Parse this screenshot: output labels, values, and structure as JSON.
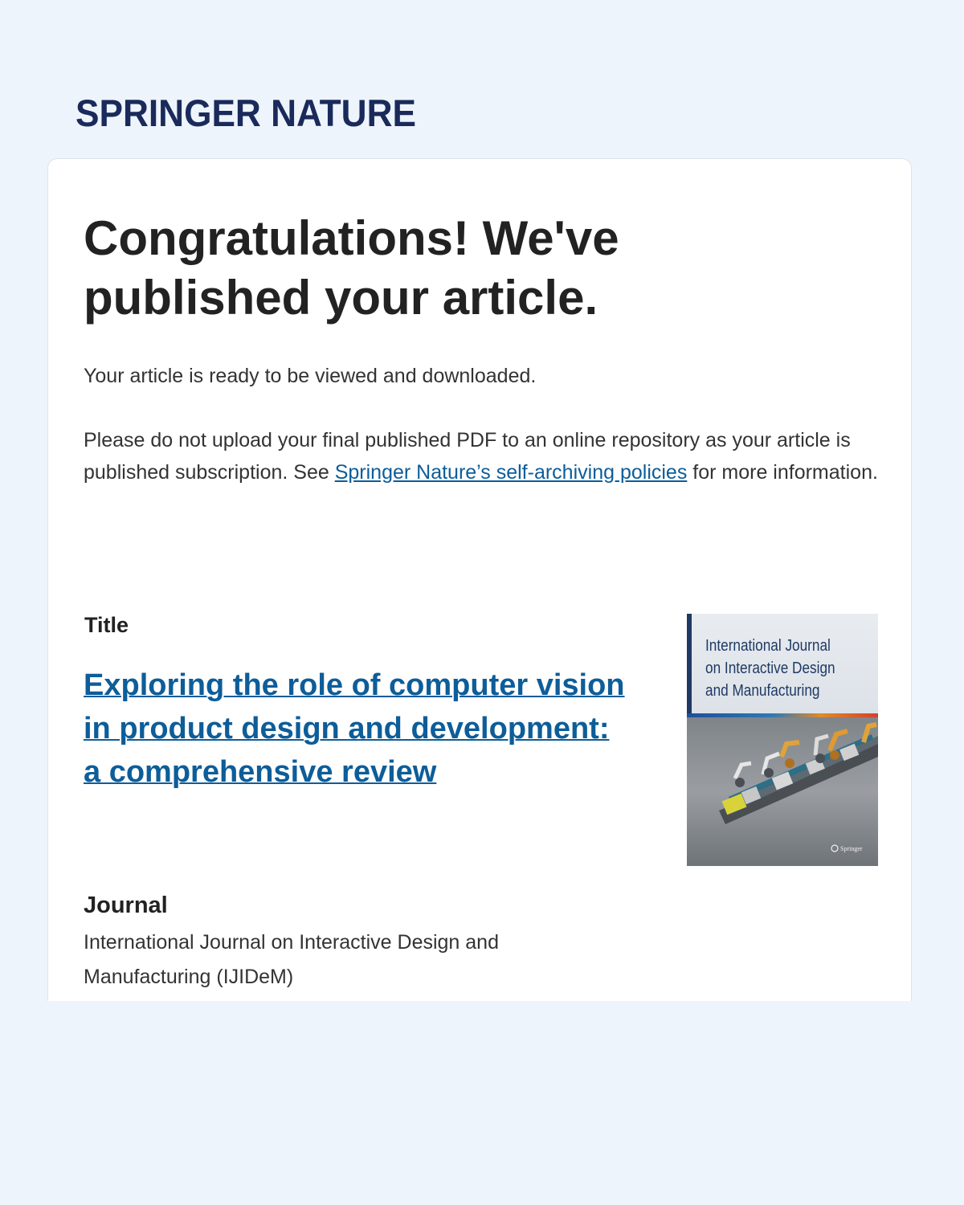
{
  "brand": {
    "logo_text": "SPRINGER NATURE",
    "color": "#1a2a5a"
  },
  "card": {
    "headline": "Congratulations! We've published your article.",
    "ready_text": "Your article is ready to be viewed and downloaded.",
    "notice": {
      "before_link": "Please do not upload your final published PDF to an online repository as your article is published subscription. See ",
      "link_text": "Springer Nature’s self-archiving policies",
      "after_link": " for more information."
    },
    "link_color": "#0d5d99"
  },
  "article": {
    "title_label": "Title",
    "title": "Exploring the role of computer vision in product design and development: a comprehensive review",
    "journal_label": "Journal",
    "journal_name": "International Journal on Interactive Design and Manufacturing (IJIDeM)"
  },
  "cover": {
    "title_lines": [
      "International Journal",
      "on Interactive Design",
      "and Manufacturing"
    ],
    "publisher_mark": "Springer",
    "image": "industrial-robot-assembly-line"
  }
}
